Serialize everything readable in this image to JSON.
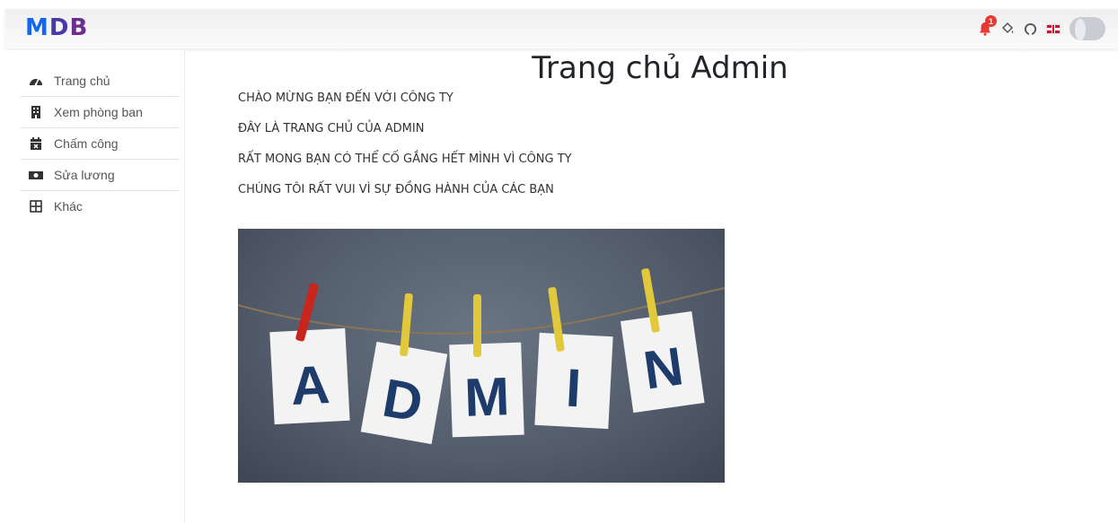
{
  "navbar": {
    "logo": {
      "m": "M",
      "d": "D",
      "b": "B"
    },
    "notification_count": "1",
    "icons": [
      "bell-icon",
      "paint-bucket-icon",
      "github-icon",
      "uk-flag-icon",
      "avatar"
    ]
  },
  "sidebar": {
    "items": [
      {
        "label": "Trang chủ",
        "icon": "dashboard-icon"
      },
      {
        "label": "Xem phòng ban",
        "icon": "building-icon"
      },
      {
        "label": "Chấm công",
        "icon": "calendar-icon"
      },
      {
        "label": "Sửa lương",
        "icon": "money-icon"
      },
      {
        "label": "Khác",
        "icon": "grid-icon"
      }
    ]
  },
  "main": {
    "title": "Trang chủ Admin",
    "messages": [
      "CHÀO MỪNG BẠN ĐẾN VỚI CÔNG TY",
      "ĐÂY LÀ TRANG CHỦ CỦA ADMIN",
      "RẤT MONG BẠN CÓ THỂ CỐ GẮNG HẾT MÌNH VÌ CÔNG TY",
      "CHÚNG TÔI RẤT VUI VÌ SỰ ĐỒNG HÀNH CỦA CÁC BẠN"
    ],
    "banner_letters": [
      "A",
      "D",
      "M",
      "I",
      "N"
    ]
  },
  "colors": {
    "brand": "#1266f1",
    "badge": "#e53935",
    "banner_text": "#1d3c6b"
  }
}
